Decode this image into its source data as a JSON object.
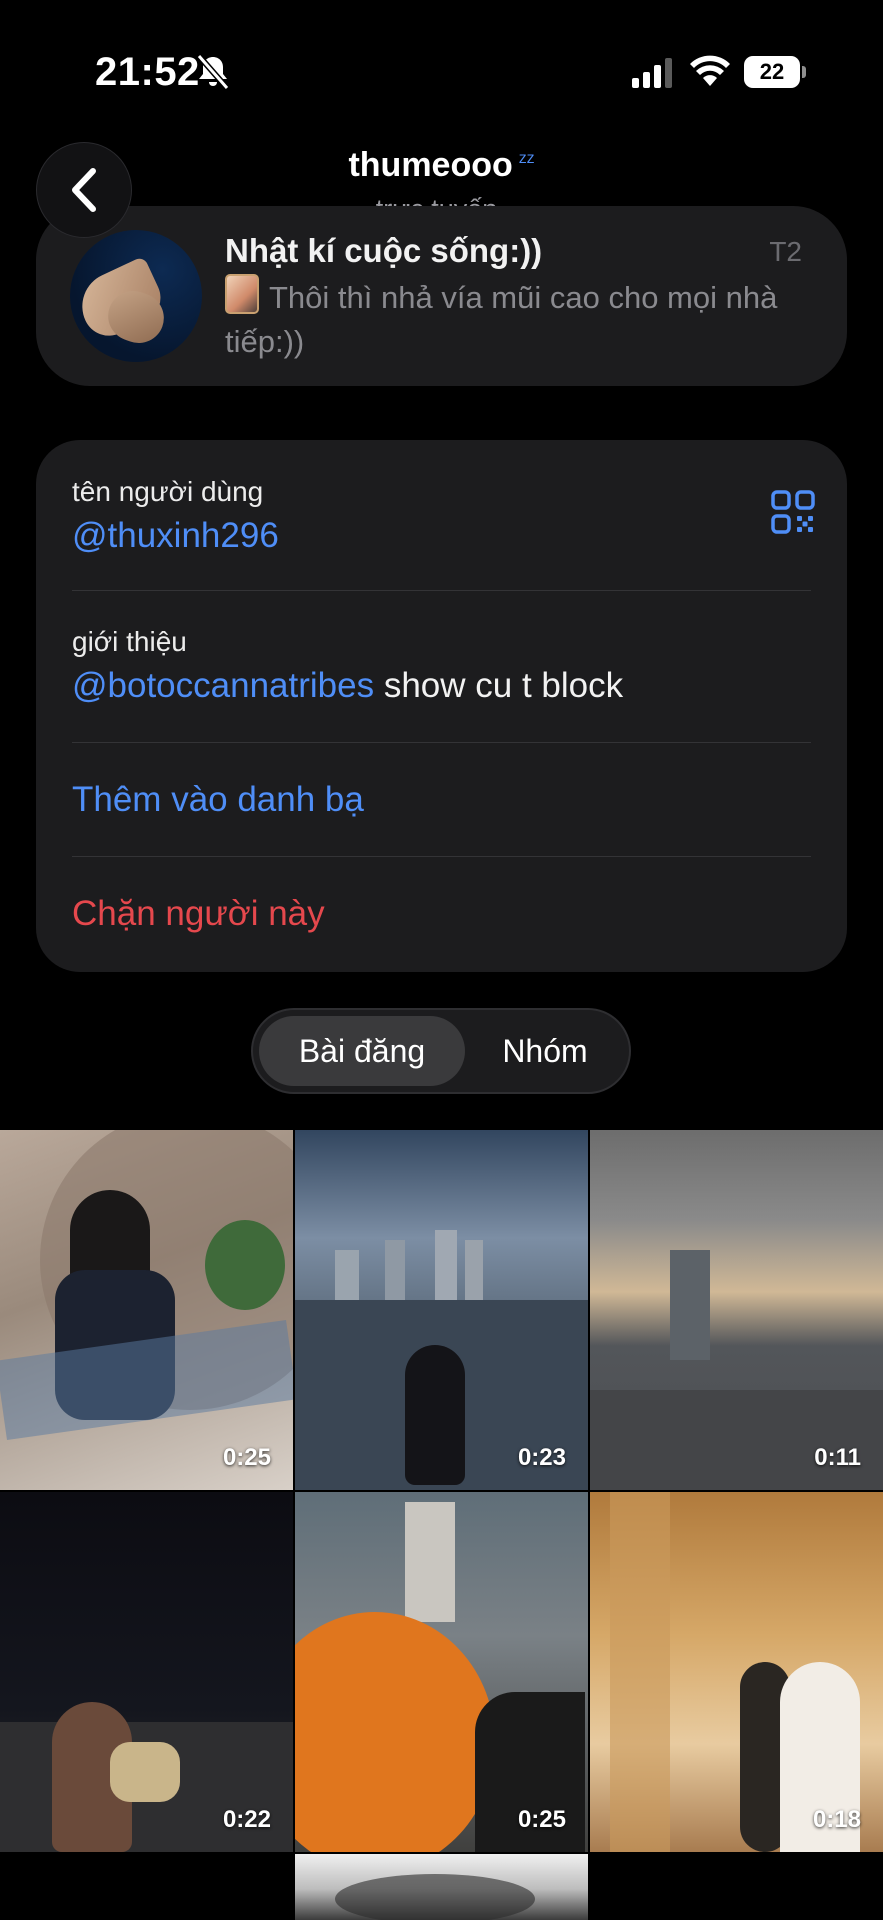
{
  "status_bar": {
    "time": "21:52",
    "battery": "22"
  },
  "header": {
    "name": "thumeooo",
    "status": "trực tuyến"
  },
  "channel": {
    "title": "Nhật kí cuộc sống:))",
    "day": "T2",
    "preview": "Thôi thì nhả vía mũi cao cho mọi nhà tiếp:))"
  },
  "info": {
    "username_label": "tên người dùng",
    "username": "@thuxinh296",
    "bio_label": "giới thiệu",
    "bio_mention": "@botoccannatribes",
    "bio_text": " show cu t block",
    "add_contact": "Thêm vào danh bạ",
    "block_user": "Chặn người này"
  },
  "tabs": {
    "posts": "Bài đăng",
    "groups": "Nhóm",
    "active": "posts"
  },
  "media": [
    {
      "duration": "0:25"
    },
    {
      "duration": "0:23"
    },
    {
      "duration": "0:11"
    },
    {
      "duration": "0:22"
    },
    {
      "duration": "0:25"
    },
    {
      "duration": "0:18"
    }
  ],
  "colors": {
    "accent": "#4f8ef7",
    "danger": "#e5484d",
    "card": "#1c1c1e",
    "background": "#000000"
  }
}
